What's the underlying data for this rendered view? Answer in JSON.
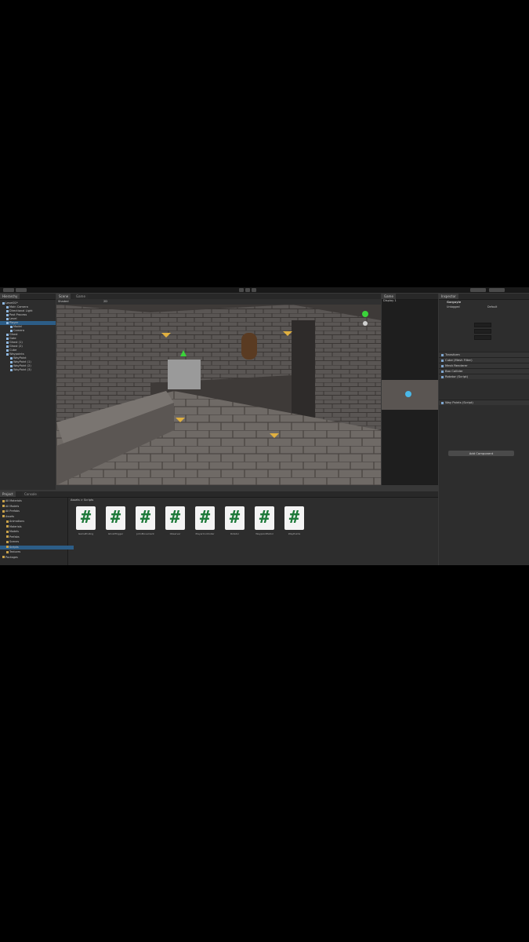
{
  "toolbar": {
    "center_buttons": [
      "play-icon",
      "pause-icon",
      "step-icon"
    ]
  },
  "hierarchy": {
    "tab": "Hierarchy",
    "items": [
      {
        "label": "Level01*",
        "depth": 0,
        "selected": false
      },
      {
        "label": "Main Camera",
        "depth": 1,
        "selected": false
      },
      {
        "label": "Directional Light",
        "depth": 1,
        "selected": false
      },
      {
        "label": "Post Process",
        "depth": 1,
        "selected": false
      },
      {
        "label": "Level",
        "depth": 1,
        "selected": false
      },
      {
        "label": "Player",
        "depth": 1,
        "selected": true
      },
      {
        "label": "Model",
        "depth": 2,
        "selected": false
      },
      {
        "label": "Camera",
        "depth": 2,
        "selected": false
      },
      {
        "label": "Ghost",
        "depth": 1,
        "selected": false
      },
      {
        "label": "Gate",
        "depth": 1,
        "selected": false
      },
      {
        "label": "Ghost (1)",
        "depth": 1,
        "selected": false
      },
      {
        "label": "Ghost (2)",
        "depth": 1,
        "selected": false
      },
      {
        "label": "Cube",
        "depth": 1,
        "selected": false
      },
      {
        "label": "Waypoints",
        "depth": 1,
        "selected": false
      },
      {
        "label": "WayPoint",
        "depth": 2,
        "selected": false
      },
      {
        "label": "WayPoint (1)",
        "depth": 2,
        "selected": false
      },
      {
        "label": "WayPoint (2)",
        "depth": 2,
        "selected": false
      },
      {
        "label": "WayPoint (3)",
        "depth": 2,
        "selected": false
      }
    ]
  },
  "scene": {
    "tabs": [
      "Scene",
      "Game"
    ],
    "shading": "Shaded",
    "mode": "2D"
  },
  "game_view": {
    "tab": "Game",
    "display": "Display 1"
  },
  "inspector": {
    "tab": "Inspector",
    "object_name": "Gargoyle",
    "tag": "Untagged",
    "layer": "Default",
    "components": [
      "Transform",
      "Cube (Mesh Filter)",
      "Mesh Renderer",
      "Box Collider",
      "Rotator (Script)",
      "Way Points (Script)"
    ],
    "add_component": "Add Component"
  },
  "project": {
    "tabs": [
      "Project",
      "Console"
    ],
    "breadcrumb": "Assets > Scripts",
    "folders": [
      "All Materials",
      "All Models",
      "All Prefabs",
      "Assets",
      "Animations",
      "Materials",
      "Models",
      "Prefabs",
      "Scenes",
      "Scripts",
      "Textures",
      "Packages"
    ],
    "scripts": [
      "GameEnding",
      "GhostTrigger",
      "JohnMovement",
      "Observer",
      "PlayerController",
      "Rotator",
      "WaypointPatrol",
      "WayPoints"
    ]
  },
  "colors": {
    "accent": "#2c5d87",
    "script_icon": "#1e7a3a"
  }
}
